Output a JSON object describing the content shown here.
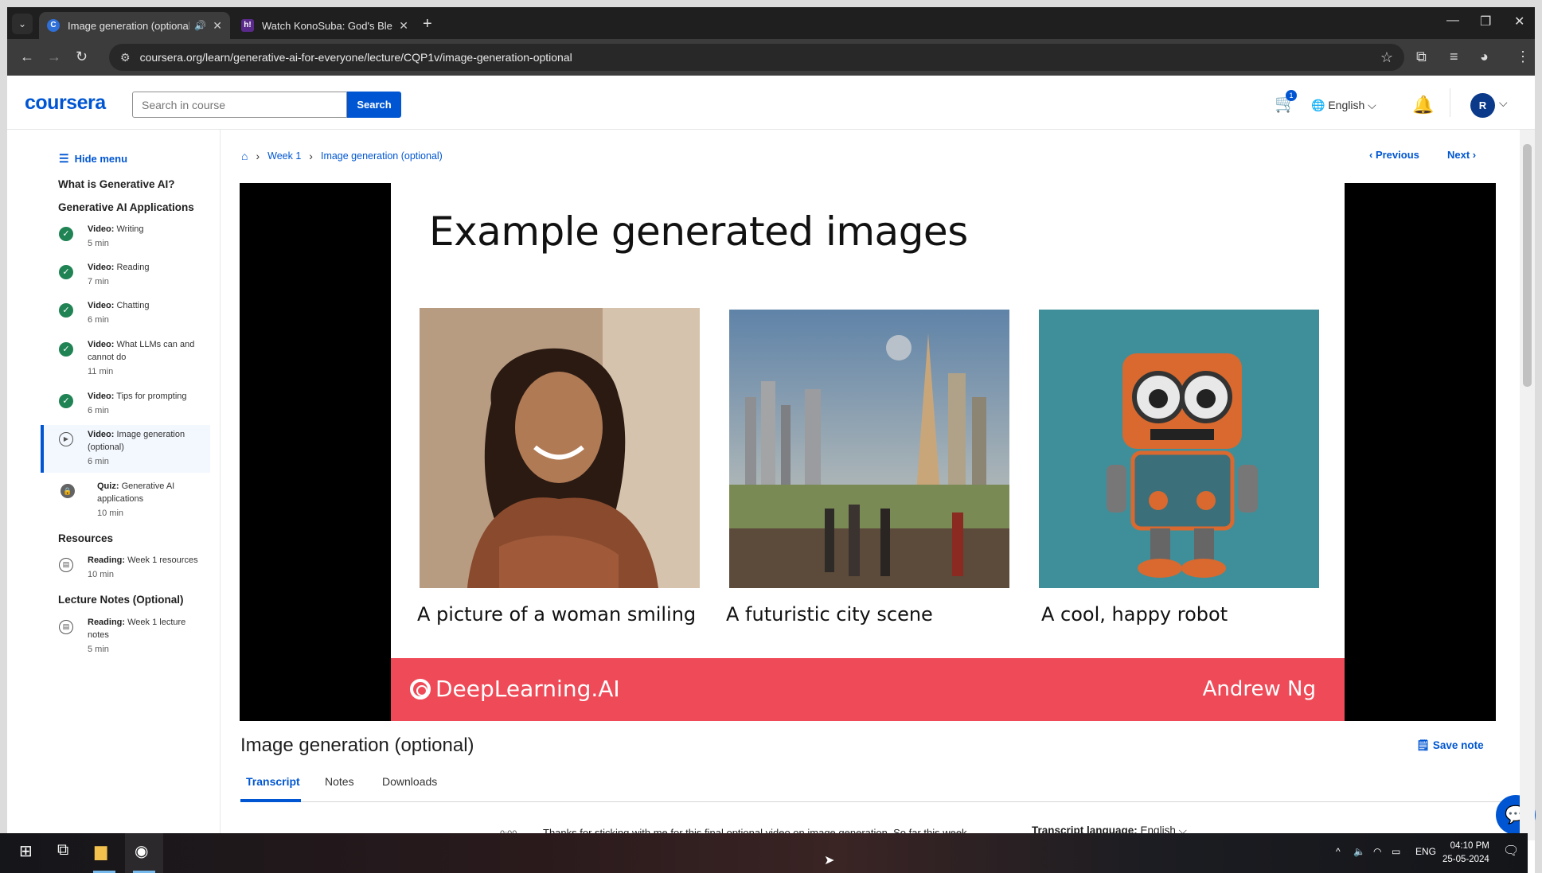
{
  "browser": {
    "tabs": [
      {
        "title": "Image generation (optional)",
        "favicon": "C",
        "active": true
      },
      {
        "title": "Watch KonoSuba: God's Blessing",
        "favicon": "h!",
        "active": false
      }
    ],
    "url": "coursera.org/learn/generative-ai-for-everyone/lecture/CQP1v/image-generation-optional"
  },
  "header": {
    "logo": "coursera",
    "search_placeholder": "Search in course",
    "search_button": "Search",
    "cart_count": "1",
    "language": "English",
    "avatar_initial": "R"
  },
  "sidebar": {
    "hide_menu": "Hide menu",
    "sections": {
      "s1": "What is Generative AI?",
      "s2": "Generative AI Applications",
      "s3": "Resources",
      "s4": "Lecture Notes (Optional)"
    },
    "items": [
      {
        "type": "Video:",
        "title": "Writing",
        "duration": "5 min",
        "status": "completed"
      },
      {
        "type": "Video:",
        "title": "Reading",
        "duration": "7 min",
        "status": "completed"
      },
      {
        "type": "Video:",
        "title": "Chatting",
        "duration": "6 min",
        "status": "completed"
      },
      {
        "type": "Video:",
        "title": "What LLMs can and cannot do",
        "duration": "11 min",
        "status": "completed"
      },
      {
        "type": "Video:",
        "title": "Tips for prompting",
        "duration": "6 min",
        "status": "completed"
      },
      {
        "type": "Video:",
        "title": "Image generation (optional)",
        "duration": "6 min",
        "status": "current"
      },
      {
        "type": "Quiz:",
        "title": "Generative AI applications",
        "duration": "10 min",
        "status": "locked"
      },
      {
        "type": "Reading:",
        "title": "Week 1 resources",
        "duration": "10 min",
        "status": "reading"
      },
      {
        "type": "Reading:",
        "title": "Week 1 lecture notes",
        "duration": "5 min",
        "status": "reading"
      }
    ]
  },
  "breadcrumb": {
    "week": "Week 1",
    "current": "Image generation (optional)"
  },
  "nav": {
    "previous": "Previous",
    "next": "Next"
  },
  "slide": {
    "title": "Example generated images",
    "captions": [
      "A picture of a woman smiling",
      "A futuristic city scene",
      "A cool, happy robot"
    ],
    "brand": "DeepLearning.AI",
    "presenter": "Andrew Ng"
  },
  "lecture": {
    "title": "Image generation (optional)",
    "save_note": "Save note",
    "tabs": [
      "Transcript",
      "Notes",
      "Downloads"
    ],
    "transcript_time": "0:00",
    "transcript_text": "Thanks for sticking with me for this final optional video on image generation. So far this week",
    "transcript_language_label": "Transcript language:",
    "transcript_language_value": "English"
  },
  "taskbar": {
    "lang": "ENG",
    "time": "04:10 PM",
    "date": "25-05-2024"
  },
  "colors": {
    "brand": "#0056d2",
    "completed": "#1f8354",
    "slide_footer": "#ef4a57"
  }
}
